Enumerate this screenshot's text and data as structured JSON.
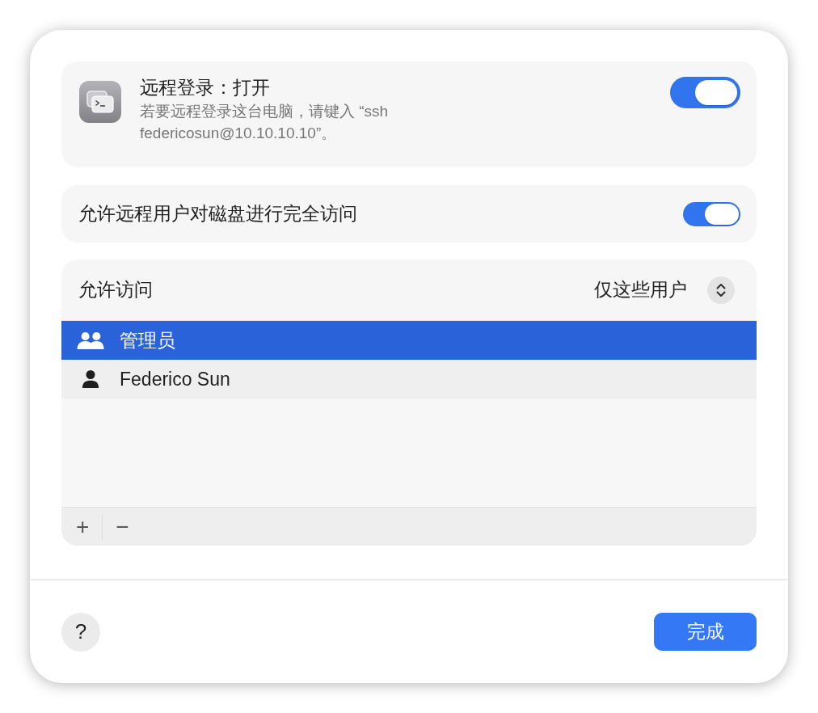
{
  "remote_login": {
    "title": "远程登录：打开",
    "description": "若要远程登录这台电脑，请键入 “ssh federicosun@10.10.10.10”。",
    "on": true
  },
  "full_disk_access": {
    "label": "允许远程用户对磁盘进行完全访问",
    "on": true
  },
  "allow_access": {
    "label": "允许访问",
    "popup": {
      "value": "仅这些用户"
    },
    "users": [
      {
        "name": "管理员",
        "kind": "group",
        "selected": true
      },
      {
        "name": "Federico Sun",
        "kind": "user",
        "selected": false
      }
    ],
    "add_button": "+",
    "remove_button": "−"
  },
  "footer": {
    "help_button": "?",
    "done_button": "完成"
  }
}
